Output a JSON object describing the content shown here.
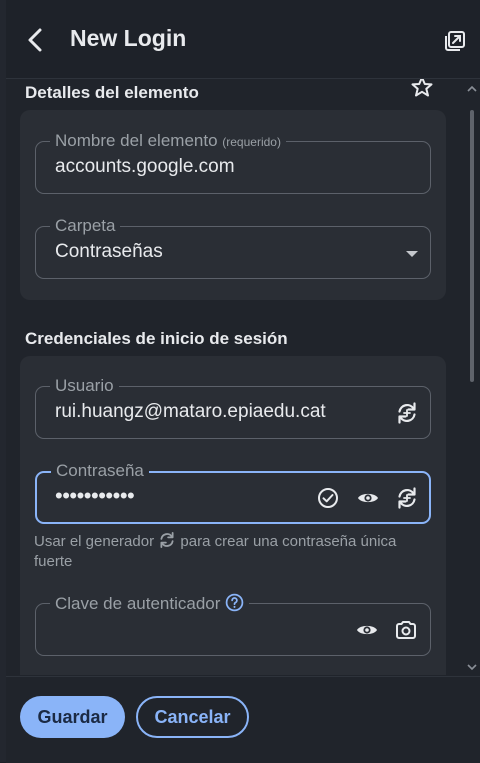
{
  "header": {
    "title": "New Login",
    "back_icon": "chevron-left-icon",
    "popout_icon": "popout-icon"
  },
  "item_details": {
    "section_title": "Detalles del elemento",
    "favorite_icon": "star-icon",
    "name_field": {
      "label": "Nombre del elemento",
      "required_label": "(requerido)",
      "value": "accounts.google.com"
    },
    "folder_field": {
      "label": "Carpeta",
      "value": "Contraseñas"
    }
  },
  "login_credentials": {
    "section_title": "Credenciales de inicio de sesión",
    "username_field": {
      "label": "Usuario",
      "value": "rui.huangz@mataro.epiaedu.cat"
    },
    "password_field": {
      "label": "Contraseña",
      "value": "•••••••••••"
    },
    "generator_hint_before": "Usar el generador",
    "generator_hint_after": "para crear una contraseña única fuerte",
    "authenticator_field": {
      "label": "Clave de autenticador",
      "value": ""
    }
  },
  "footer": {
    "save_label": "Guardar",
    "cancel_label": "Cancelar"
  },
  "colors": {
    "accent": "#8ab4f8",
    "background": "#20242b",
    "card": "#2a2e35"
  }
}
